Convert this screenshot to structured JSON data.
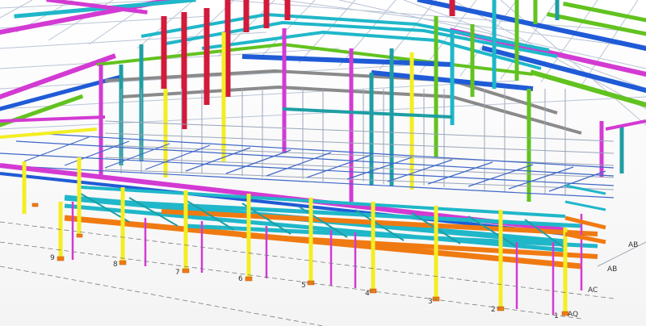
{
  "view": {
    "background": "#ffffff",
    "member_colors": {
      "blue": "#1f5bd6",
      "magenta": "#d33ad3",
      "cyan": "#1fb7c9",
      "green": "#62c21f",
      "red": "#d21a3a",
      "yellow": "#f3ee22",
      "orange": "#f07a12",
      "grey": "#8a8a8a",
      "teal": "#1e9ea4"
    }
  },
  "grid_labels": {
    "columns": [
      "9",
      "8",
      "7",
      "6",
      "5",
      "4",
      "3",
      "2",
      "1"
    ],
    "rows": [
      "AB",
      "AB",
      "AC",
      "AQ"
    ]
  }
}
